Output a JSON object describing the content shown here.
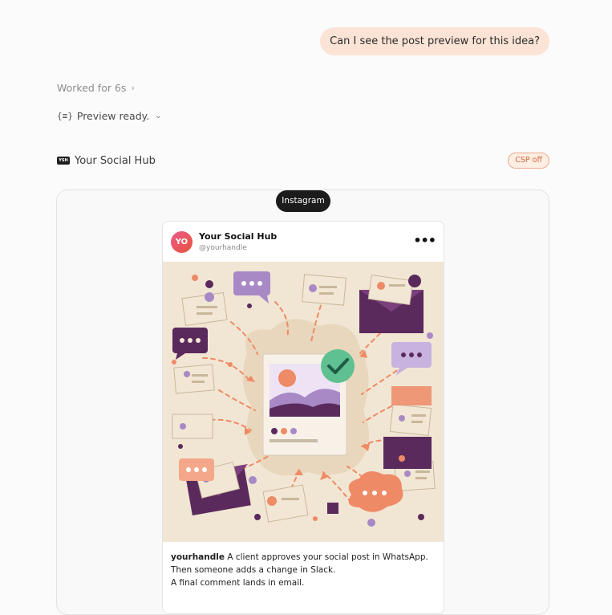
{
  "conversation": {
    "user_message": "Can I see the post preview for this idea?",
    "worked_label": "Worked for 6s",
    "preview_status": "Preview ready."
  },
  "app": {
    "name": "Your Social Hub",
    "csp_badge": "CSP off"
  },
  "preview": {
    "platform": "Instagram",
    "post": {
      "avatar_initials": "YO",
      "account_name": "Your Social Hub",
      "handle": "@yourhandle",
      "caption_user": "yourhandle",
      "caption_lines": [
        "A client approves your social post in WhatsApp.",
        "Then someone adds a change in Slack.",
        "A final comment lands in email."
      ]
    }
  },
  "colors": {
    "accent_orange": "#ef8a66",
    "accent_purple": "#5a2a5c",
    "lilac": "#a889c6",
    "check_green": "#3f9f78",
    "paper": "#f1e6d4"
  },
  "icons": [
    "chevron-right-icon",
    "braces-icon",
    "chevron-down-icon",
    "app-logo-icon",
    "more-icon",
    "check-icon",
    "envelope-icon",
    "chat-bubble-icon"
  ]
}
